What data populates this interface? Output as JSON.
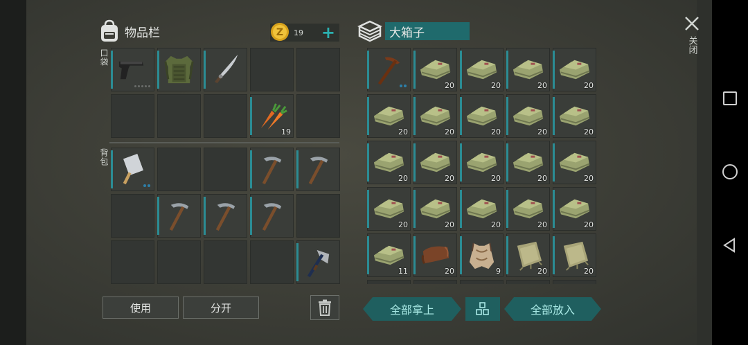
{
  "inventory": {
    "title": "物品栏",
    "coins": "19",
    "plus": "+",
    "pocket_label": "口袋",
    "backpack_label": "背包",
    "pocket_slots": [
      {
        "item": "pistol",
        "count": "",
        "dots": "gray"
      },
      {
        "item": "armor-vest",
        "count": "",
        "dots": ""
      },
      {
        "item": "machete",
        "count": "",
        "dots": ""
      },
      {
        "item": "",
        "count": "",
        "dots": ""
      },
      {
        "item": "",
        "count": "",
        "dots": ""
      },
      {
        "item": "",
        "count": "",
        "dots": ""
      },
      {
        "item": "",
        "count": "",
        "dots": ""
      },
      {
        "item": "",
        "count": "",
        "dots": ""
      },
      {
        "item": "carrot",
        "count": "19",
        "dots": ""
      },
      {
        "item": "",
        "count": "",
        "dots": ""
      }
    ],
    "backpack_slots": [
      {
        "item": "cleaver",
        "count": "",
        "dots": "blue"
      },
      {
        "item": "",
        "count": "",
        "dots": ""
      },
      {
        "item": "",
        "count": "",
        "dots": ""
      },
      {
        "item": "pickaxe",
        "count": "",
        "dots": ""
      },
      {
        "item": "pickaxe",
        "count": "",
        "dots": ""
      },
      {
        "item": "",
        "count": "",
        "dots": ""
      },
      {
        "item": "pickaxe",
        "count": "",
        "dots": ""
      },
      {
        "item": "pickaxe",
        "count": "",
        "dots": ""
      },
      {
        "item": "pickaxe",
        "count": "",
        "dots": ""
      },
      {
        "item": "",
        "count": "",
        "dots": ""
      },
      {
        "item": "",
        "count": "",
        "dots": ""
      },
      {
        "item": "",
        "count": "",
        "dots": ""
      },
      {
        "item": "",
        "count": "",
        "dots": ""
      },
      {
        "item": "",
        "count": "",
        "dots": ""
      },
      {
        "item": "hatchet",
        "count": "",
        "dots": ""
      }
    ],
    "use_label": "使用",
    "split_label": "分开"
  },
  "chest": {
    "title": "大箱子",
    "slots": [
      {
        "item": "wood-pickaxe",
        "count": "",
        "dots": "blue"
      },
      {
        "item": "cloth",
        "count": "20"
      },
      {
        "item": "cloth",
        "count": "20"
      },
      {
        "item": "cloth",
        "count": "20"
      },
      {
        "item": "cloth",
        "count": "20"
      },
      {
        "item": "cloth",
        "count": "20"
      },
      {
        "item": "cloth",
        "count": "20"
      },
      {
        "item": "cloth",
        "count": "20"
      },
      {
        "item": "cloth",
        "count": "20"
      },
      {
        "item": "cloth",
        "count": "20"
      },
      {
        "item": "cloth",
        "count": "20"
      },
      {
        "item": "cloth",
        "count": "20"
      },
      {
        "item": "cloth",
        "count": "20"
      },
      {
        "item": "cloth",
        "count": "20"
      },
      {
        "item": "cloth",
        "count": "20"
      },
      {
        "item": "cloth",
        "count": "20"
      },
      {
        "item": "cloth",
        "count": "20"
      },
      {
        "item": "cloth",
        "count": "20"
      },
      {
        "item": "cloth",
        "count": "20"
      },
      {
        "item": "cloth",
        "count": "20"
      },
      {
        "item": "cloth",
        "count": "11"
      },
      {
        "item": "leather",
        "count": "20"
      },
      {
        "item": "hide",
        "count": "9"
      },
      {
        "item": "burlap",
        "count": "20"
      },
      {
        "item": "burlap",
        "count": "20"
      }
    ],
    "take_all_label": "全部拿上",
    "put_all_label": "全部放入"
  },
  "close_label": "关闭",
  "colors": {
    "accent": "#2b8c94",
    "button_teal": "#1f5f5f",
    "background": "#3c3d36"
  }
}
